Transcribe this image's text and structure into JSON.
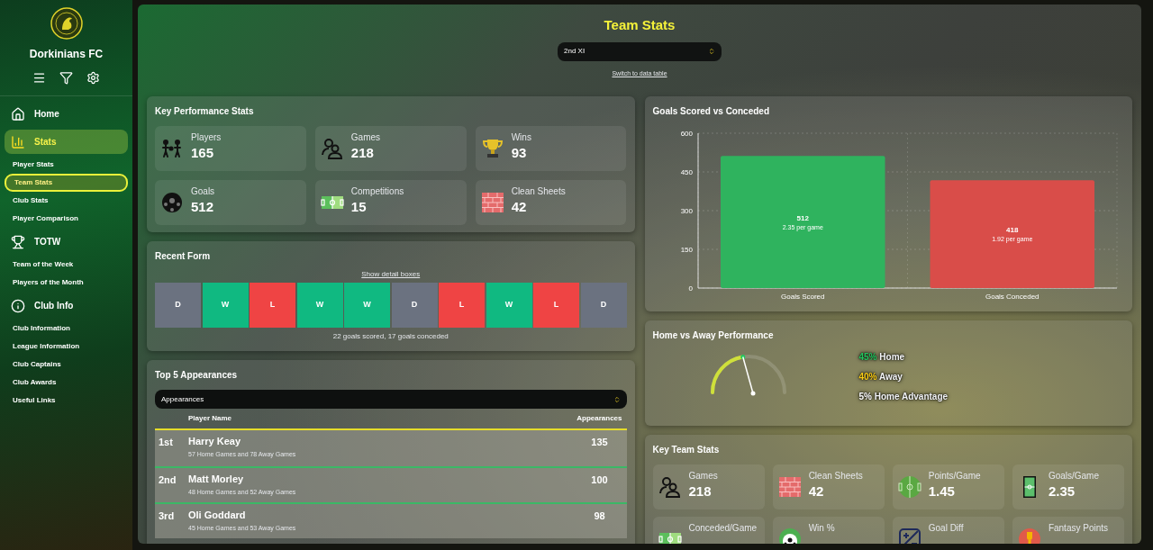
{
  "sidebar": {
    "club_name": "Dorkinians FC",
    "sections": [
      {
        "label": "Home",
        "selected": false
      },
      {
        "label": "Stats",
        "selected": true,
        "children": [
          {
            "label": "Player Stats",
            "selected": false
          },
          {
            "label": "Team Stats",
            "selected": true
          },
          {
            "label": "Club Stats",
            "selected": false
          },
          {
            "label": "Player Comparison",
            "selected": false
          }
        ]
      },
      {
        "label": "TOTW",
        "selected": false,
        "children": [
          {
            "label": "Team of the Week",
            "selected": false
          },
          {
            "label": "Players of the Month",
            "selected": false
          }
        ]
      },
      {
        "label": "Club Info",
        "selected": false,
        "children": [
          {
            "label": "Club Information",
            "selected": false
          },
          {
            "label": "League Information",
            "selected": false
          },
          {
            "label": "Club Captains",
            "selected": false
          },
          {
            "label": "Club Awards",
            "selected": false
          },
          {
            "label": "Useful Links",
            "selected": false
          }
        ]
      }
    ]
  },
  "page": {
    "title": "Team Stats",
    "team_select": "2nd XI",
    "switch_link": "Switch to data table"
  },
  "key_performance": {
    "title": "Key Performance Stats",
    "stats": [
      {
        "label": "Players",
        "value": "165"
      },
      {
        "label": "Games",
        "value": "218"
      },
      {
        "label": "Wins",
        "value": "93"
      },
      {
        "label": "Goals",
        "value": "512"
      },
      {
        "label": "Competitions",
        "value": "15"
      },
      {
        "label": "Clean Sheets",
        "value": "42"
      }
    ]
  },
  "recent_form": {
    "title": "Recent Form",
    "toggle_link": "Show detail boxes",
    "results": [
      {
        "result": "D",
        "color": "#6b7280"
      },
      {
        "result": "W",
        "color": "#10b981"
      },
      {
        "result": "L",
        "color": "#ef4444"
      },
      {
        "result": "W",
        "color": "#10b981"
      },
      {
        "result": "W",
        "color": "#10b981"
      },
      {
        "result": "D",
        "color": "#6b7280"
      },
      {
        "result": "L",
        "color": "#ef4444"
      },
      {
        "result": "W",
        "color": "#10b981"
      },
      {
        "result": "L",
        "color": "#ef4444"
      },
      {
        "result": "D",
        "color": "#6b7280"
      }
    ],
    "summary": "22 goals scored, 17 goals conceded"
  },
  "top_five": {
    "title": "Top 5 Appearances",
    "select": "Appearances",
    "columns": [
      "Player Name",
      "Appearances"
    ],
    "rows": [
      {
        "rank": "1st",
        "name": "Harry Keay",
        "detail": "57 Home Games and 78 Away Games",
        "value": "135"
      },
      {
        "rank": "2nd",
        "name": "Matt Morley",
        "detail": "48 Home Games and 52 Away Games",
        "value": "100"
      },
      {
        "rank": "3rd",
        "name": "Oli Goddard",
        "detail": "45 Home Games and 53 Away Games",
        "value": "98"
      }
    ]
  },
  "goals_chart": {
    "title": "Goals Scored vs Conceded",
    "chart_data": {
      "type": "bar",
      "series": [
        {
          "name": "Goals Scored",
          "color": "#2fb35e",
          "values": [
            512,
            null
          ]
        },
        {
          "name": "Goals Conceded",
          "color": "#d94d49",
          "values": [
            null,
            418
          ]
        }
      ],
      "ylim": [
        0,
        600
      ],
      "yticks": [
        0,
        150,
        300,
        450,
        600
      ],
      "grid": true,
      "data_labels": true,
      "annotations": [
        "2.35 per game",
        "1.92 per game"
      ]
    }
  },
  "home_away": {
    "title": "Home vs Away Performance",
    "gauge": {
      "level": 0.45
    },
    "lines": [
      {
        "value": "45%",
        "label": "Home",
        "color": "#22c55e"
      },
      {
        "value": "40%",
        "label": "Away",
        "color": "#facc15"
      },
      {
        "value": "5%",
        "label": "Home Advantage",
        "color": "#ffffff"
      }
    ]
  },
  "key_team_stats": {
    "title": "Key Team Stats",
    "stats": [
      {
        "label": "Games",
        "value": "218"
      },
      {
        "label": "Clean Sheets",
        "value": "42"
      },
      {
        "label": "Points/Game",
        "value": "1.45"
      },
      {
        "label": "Goals/Game",
        "value": "2.35"
      },
      {
        "label": "Conceded/Game"
      },
      {
        "label": "Win %"
      },
      {
        "label": "Goal Diff"
      },
      {
        "label": "Fantasy Points"
      }
    ]
  }
}
